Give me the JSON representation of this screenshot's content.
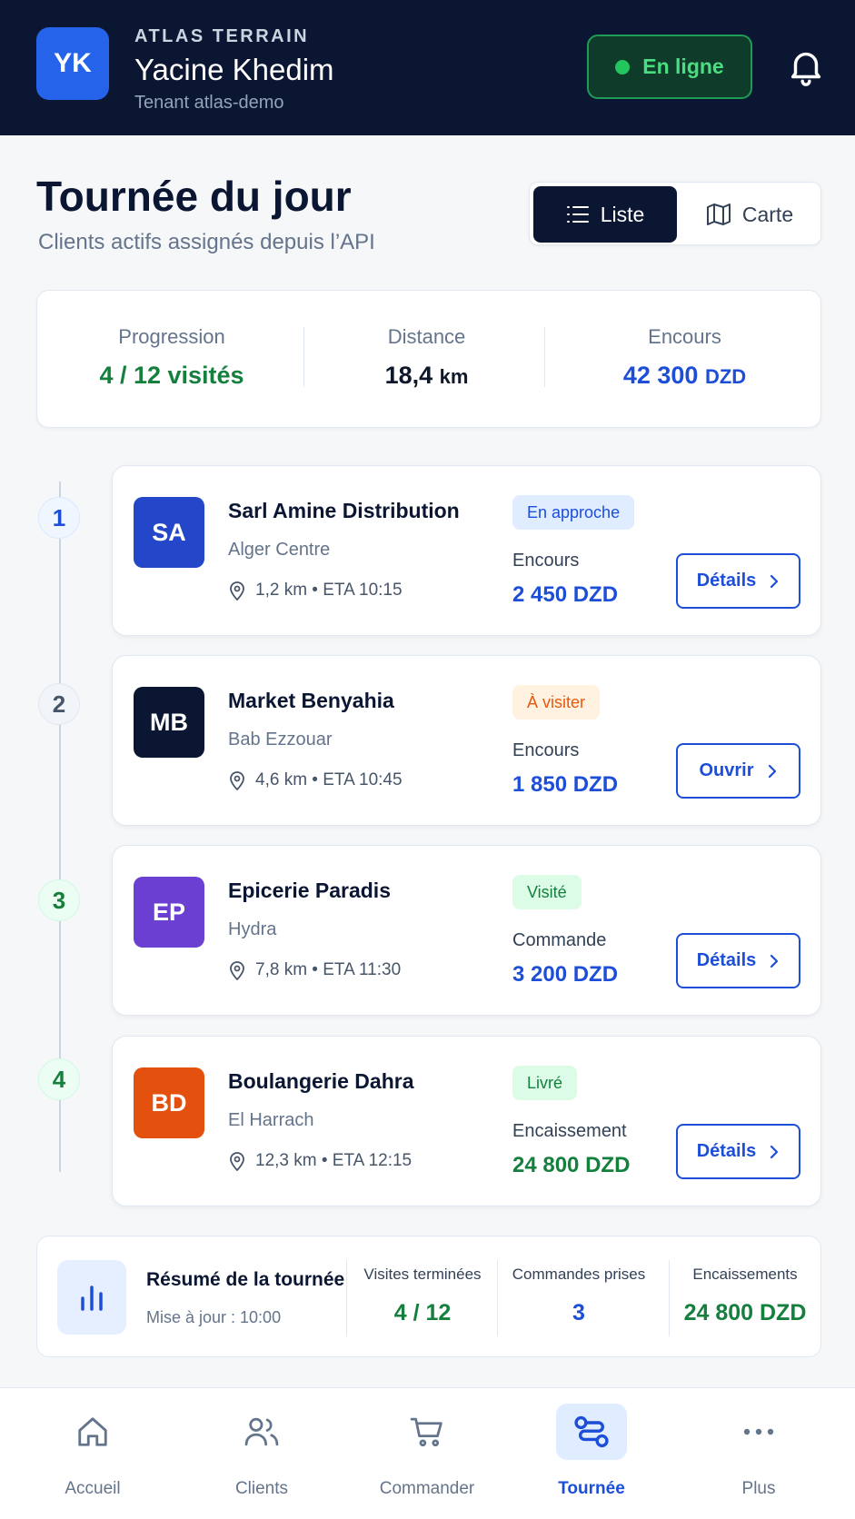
{
  "header": {
    "avatar_initials": "YK",
    "brand": "ATLAS TERRAIN",
    "user_name": "Yacine Khedim",
    "tenant": "Tenant atlas-demo",
    "status": "En ligne",
    "status_color": "#22c55e"
  },
  "title": {
    "heading": "Tournée du jour",
    "subtitle": "Clients actifs assignés depuis l’API"
  },
  "view_toggle": {
    "list_label": "Liste",
    "map_label": "Carte",
    "selected": "Liste"
  },
  "stats": {
    "progression_label": "Progression",
    "progression_value": "4 / 12 visités",
    "distance_label": "Distance",
    "distance_value": "18,4",
    "distance_unit": "km",
    "encours_label": "Encours",
    "encours_value": "42 300",
    "encours_unit": "DZD"
  },
  "stops": [
    {
      "step": "1",
      "initials": "SA",
      "avatar_color": "#2347c8",
      "name": "Sarl Amine Distribution",
      "area": "Alger Centre",
      "meta": "1,2 km • ETA 10:15",
      "badge": "En approche",
      "amount_label": "Encours",
      "amount_value": "2 450 DZD",
      "button": "Détails"
    },
    {
      "step": "2",
      "initials": "MB",
      "avatar_color": "#0b1633",
      "name": "Market Benyahia",
      "area": "Bab Ezzouar",
      "meta": "4,6 km • ETA 10:45",
      "badge": "À visiter",
      "amount_label": "Encours",
      "amount_value": "1 850 DZD",
      "button": "Ouvrir"
    },
    {
      "step": "3",
      "initials": "EP",
      "avatar_color": "#6b3fd1",
      "name": "Epicerie Paradis",
      "area": "Hydra",
      "meta": "7,8 km • ETA 11:30",
      "badge": "Visité",
      "amount_label": "Commande",
      "amount_value": "3 200 DZD",
      "button": "Détails"
    },
    {
      "step": "4",
      "initials": "BD",
      "avatar_color": "#e4510f",
      "name": "Boulangerie Dahra",
      "area": "El Harrach",
      "meta": "12,3 km • ETA 12:15",
      "badge": "Livré",
      "amount_label": "Encaissement",
      "amount_value": "24 800 DZD",
      "button": "Détails"
    }
  ],
  "summary": {
    "title": "Résumé de la tournée",
    "updated": "Mise à jour : 10:00",
    "visits_label": "Visites terminées",
    "visits_value": "4 / 12",
    "orders_label": "Commandes prises",
    "orders_value": "3",
    "collections_label": "Encaissements",
    "collections_value": "24 800 DZD"
  },
  "nav": {
    "items": [
      {
        "label": "Accueil",
        "icon": "home-icon"
      },
      {
        "label": "Clients",
        "icon": "users-icon"
      },
      {
        "label": "Commander",
        "icon": "cart-icon"
      },
      {
        "label": "Tournée",
        "icon": "route-icon"
      },
      {
        "label": "Plus",
        "icon": "more-icon"
      }
    ],
    "active": "Tournée"
  },
  "colors": {
    "navy": "#0b1633",
    "accent_blue": "#1d4ed8",
    "success_green": "#15803d",
    "warning_orange": "#ea580c"
  }
}
